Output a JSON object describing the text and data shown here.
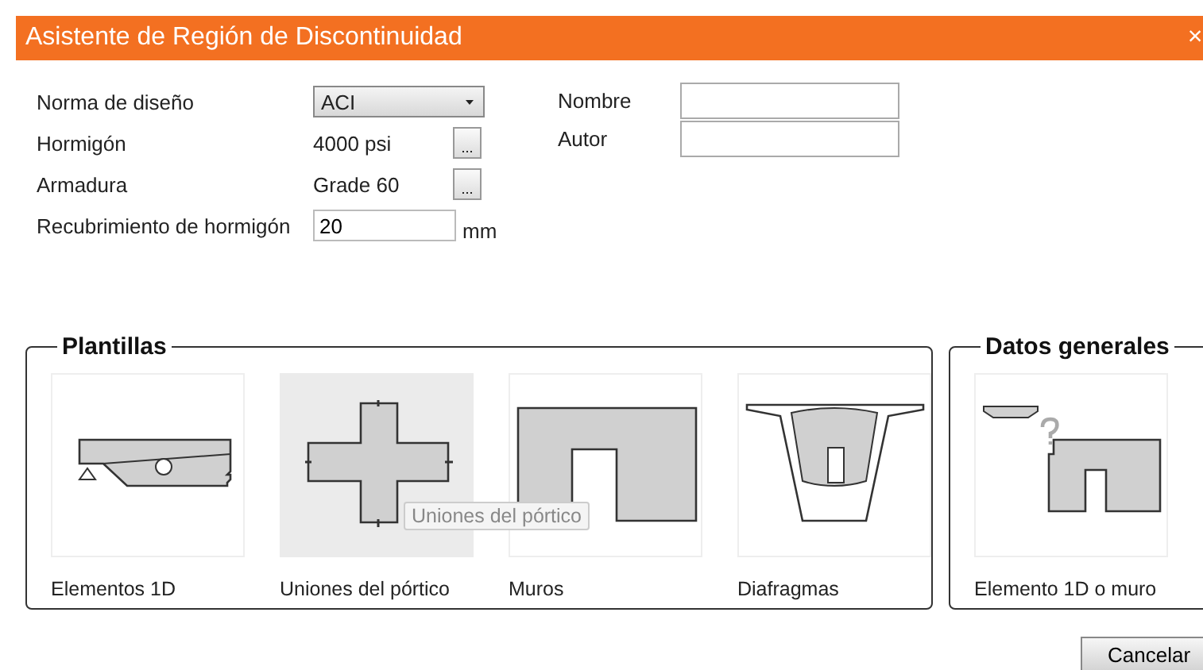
{
  "window": {
    "title": "Asistente de Región de Discontinuidad",
    "close": "×"
  },
  "form": {
    "left": [
      {
        "kind": "select",
        "label": "Norma de diseño",
        "value": "ACI"
      },
      {
        "kind": "picker",
        "label": "Hormigón",
        "value": "4000 psi",
        "button": "..."
      },
      {
        "kind": "picker",
        "label": "Armadura",
        "value": "Grade 60",
        "button": "..."
      },
      {
        "kind": "input",
        "label": "Recubrimiento de hormigón",
        "value": "20",
        "unit": "mm"
      }
    ],
    "right": [
      {
        "label": "Nombre"
      },
      {
        "label": "Autor"
      }
    ]
  },
  "groups": [
    {
      "title": "Plantillas",
      "items": [
        {
          "kind": "beam",
          "label": "Elementos 1D",
          "selected": false
        },
        {
          "kind": "cross",
          "label": "Uniones del pórtico",
          "selected": true
        },
        {
          "kind": "wall",
          "label": "Muros",
          "selected": false
        },
        {
          "kind": "diaphragm",
          "label": "Diafragmas",
          "selected": false
        }
      ]
    },
    {
      "title": "Datos generales",
      "items": [
        {
          "kind": "general",
          "label": "Elemento 1D o muro",
          "selected": false
        }
      ]
    }
  ],
  "tooltip": "Uniones del pórtico",
  "buttons": [
    "Cancelar"
  ]
}
